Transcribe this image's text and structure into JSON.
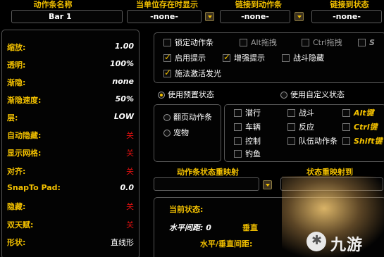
{
  "header": {
    "bar_name_label": "动作条名称",
    "bar_name_value": "Bar 1",
    "show_unit_label": "当单位存在时显示",
    "show_unit_value": "-none-",
    "link_bar_label": "链接到动作条",
    "link_bar_value": "-none-",
    "link_state_label": "链接到状态",
    "link_state_value": "-none-"
  },
  "settings": [
    {
      "label": "缩放:",
      "value": "1.00",
      "style": "normal"
    },
    {
      "label": "透明:",
      "value": "100%",
      "style": "normal"
    },
    {
      "label": "渐隐:",
      "value": "none",
      "style": "normal"
    },
    {
      "label": "渐隐速度:",
      "value": "50%",
      "style": "normal"
    },
    {
      "label": "层:",
      "value": "LOW",
      "style": "normal"
    },
    {
      "label": "自动隐藏:",
      "value": "关",
      "style": "red"
    },
    {
      "label": "显示网格:",
      "value": "关",
      "style": "red"
    },
    {
      "label": "对齐:",
      "value": "关",
      "style": "red"
    },
    {
      "label": "SnapTo Pad:",
      "value": "0.0",
      "style": "normal"
    },
    {
      "label": "隐藏:",
      "value": "关",
      "style": "red"
    },
    {
      "label": "双天赋:",
      "value": "关",
      "style": "red"
    },
    {
      "label": "形状:",
      "value": "直线形",
      "style": "plain"
    }
  ],
  "options": {
    "lock_bar": "锁定动作条",
    "alt_drag_key": "Alt",
    "alt_drag_suffix": "拖拽",
    "ctrl_drag_key": "Ctrl",
    "ctrl_drag_suffix": "拖拽",
    "shift_drag_partial": "S",
    "enable_tooltip": "启用提示",
    "enhanced_tooltip": "增强提示",
    "hide_in_combat": "战斗隐藏",
    "spell_glow": "施法激活发光"
  },
  "states": {
    "use_preset": "使用预置状态",
    "use_custom": "使用自定义状态",
    "page_bar": "翻页动作条",
    "pet": "宠物",
    "stealth": "潜行",
    "combat": "战斗",
    "alt_key": "Alt键",
    "vehicle": "车辆",
    "reaction": "反应",
    "ctrl_key": "Ctrl键",
    "control": "控制",
    "party_bar": "队伍动作条",
    "shift_key": "Shift键",
    "fishing": "钓鱼"
  },
  "remap": {
    "bar_state_remap": "动作条状态重映射",
    "state_remap_to": "状态重映射到"
  },
  "current": {
    "current_state": "当前状态:",
    "h_spacing": "水平间距: 0",
    "v_spacing_partial": "垂直",
    "hv_spacing": "水平/垂直间距:"
  },
  "watermark": "九游"
}
